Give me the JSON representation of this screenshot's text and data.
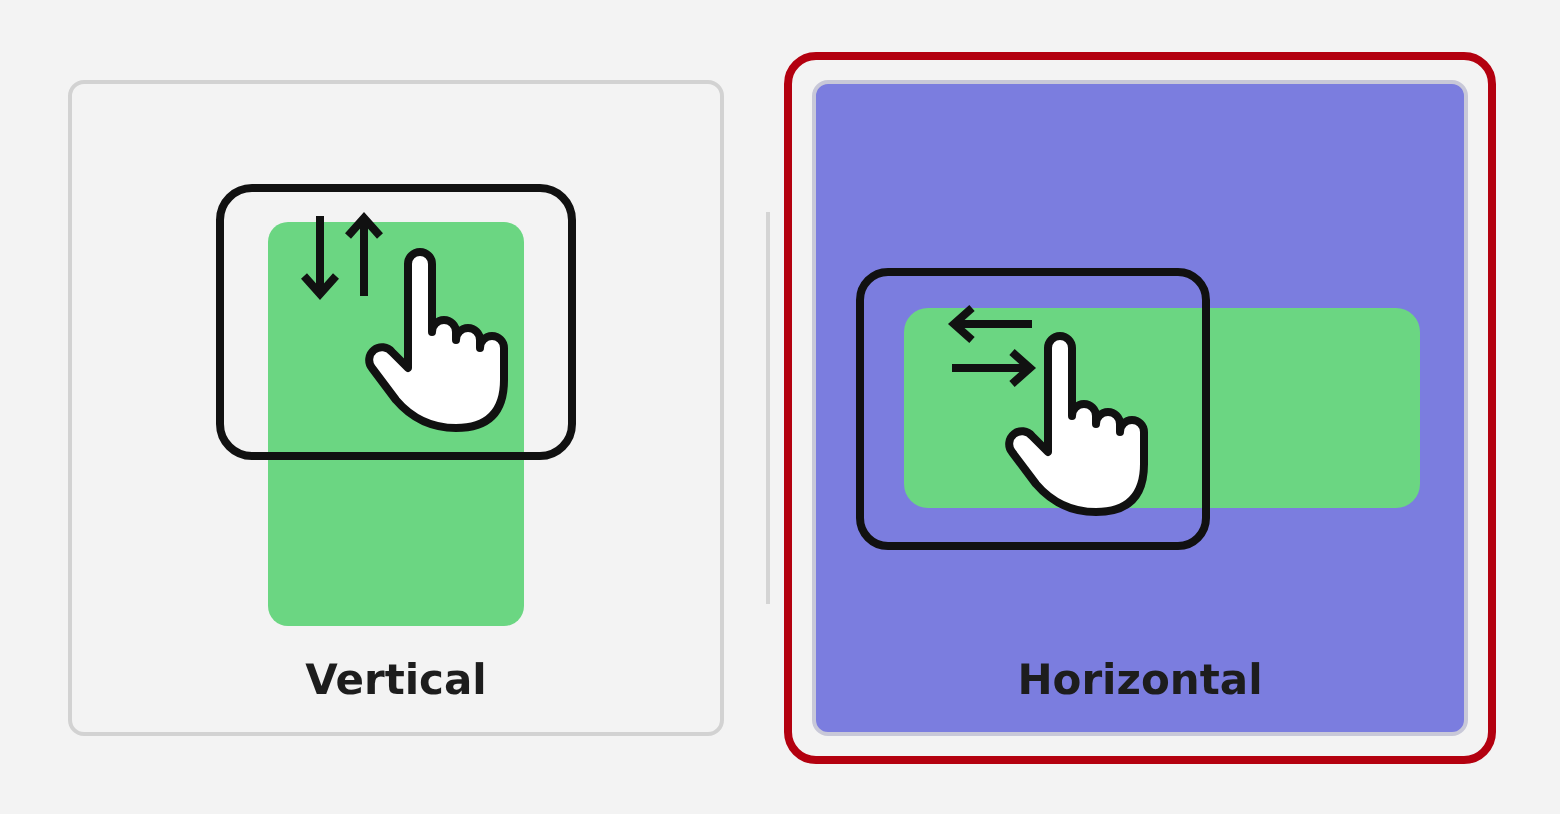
{
  "options": [
    {
      "label": "Vertical",
      "kind": "vertical",
      "selected": false
    },
    {
      "label": "Horizontal",
      "kind": "horizontal",
      "selected": true
    }
  ]
}
